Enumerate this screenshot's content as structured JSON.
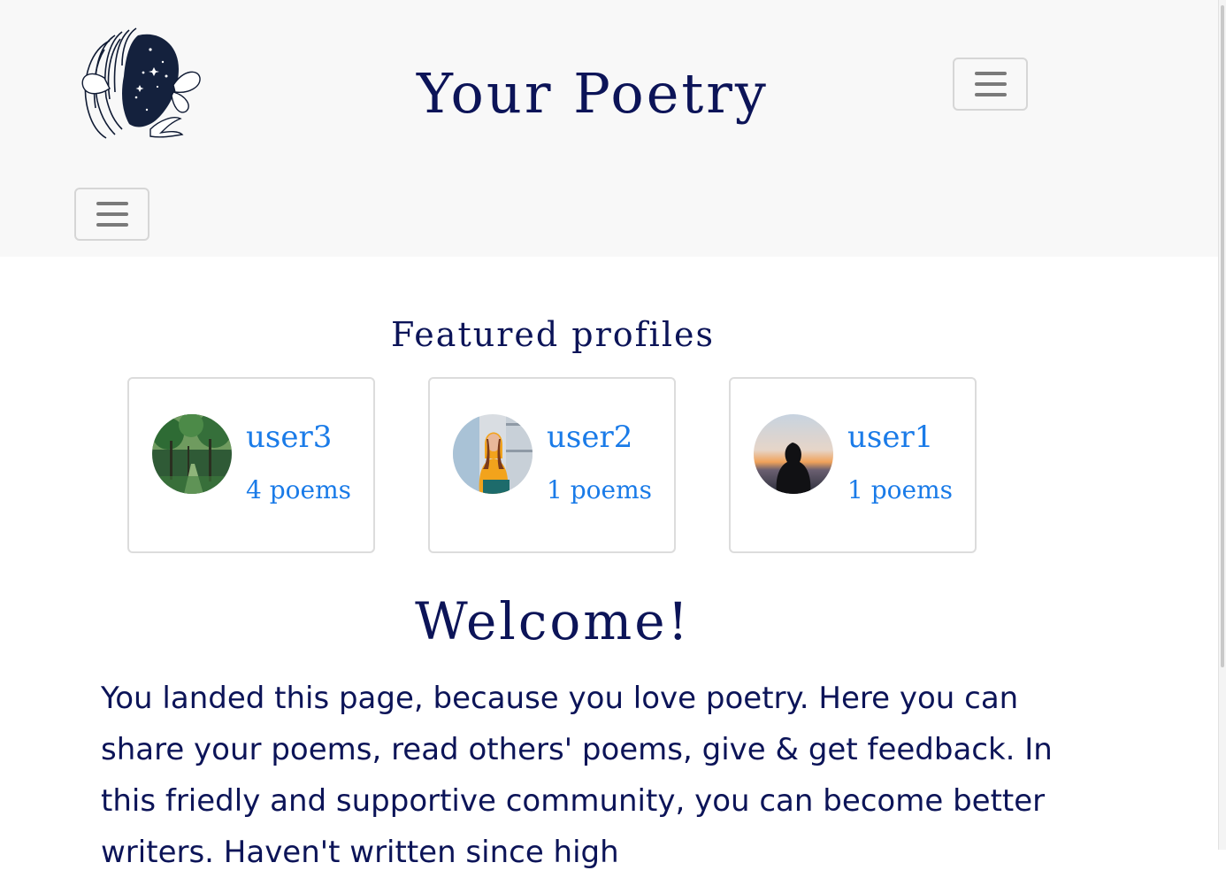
{
  "header": {
    "logo_icon": "woman-butterfly-logo",
    "title": "Your Poetry",
    "menu_toggle_icon": "hamburger-menu-icon"
  },
  "featured": {
    "title": "Featured profiles",
    "profiles": [
      {
        "username": "user3",
        "poems": "4 poems",
        "avatar": "forest-path-photo"
      },
      {
        "username": "user2",
        "poems": "1 poems",
        "avatar": "woman-orange-hoodie-photo"
      },
      {
        "username": "user1",
        "poems": "1 poems",
        "avatar": "hooded-figure-sunset-photo"
      }
    ]
  },
  "welcome": {
    "title": "Welcome!",
    "text": "You landed this page, because you love poetry. Here you can share your poems, read others' poems, give & get feedback. In this friedly and supportive community, you can become better writers. Haven't written since high"
  },
  "colors": {
    "brand_navy": "#0c1458",
    "link_blue": "#1a7be8",
    "header_bg": "#f8f8f8"
  }
}
